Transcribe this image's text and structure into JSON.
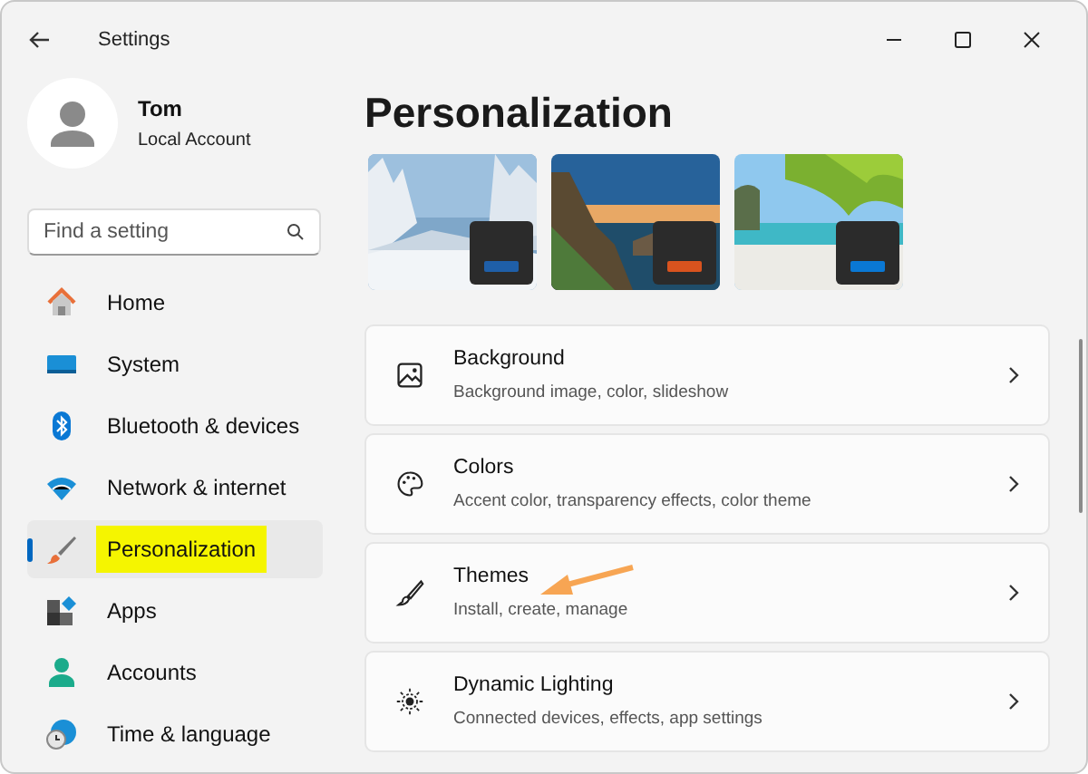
{
  "window": {
    "title": "Settings"
  },
  "account": {
    "name": "Tom",
    "type": "Local Account"
  },
  "search": {
    "placeholder": "Find a setting"
  },
  "sidebar": {
    "items": [
      {
        "label": "Home",
        "kind": "home",
        "selected": false,
        "highlighted": false
      },
      {
        "label": "System",
        "kind": "system",
        "selected": false,
        "highlighted": false
      },
      {
        "label": "Bluetooth & devices",
        "kind": "bluetooth",
        "selected": false,
        "highlighted": false
      },
      {
        "label": "Network & internet",
        "kind": "network",
        "selected": false,
        "highlighted": false
      },
      {
        "label": "Personalization",
        "kind": "personalization",
        "selected": true,
        "highlighted": true
      },
      {
        "label": "Apps",
        "kind": "apps",
        "selected": false,
        "highlighted": false
      },
      {
        "label": "Accounts",
        "kind": "accounts",
        "selected": false,
        "highlighted": false
      },
      {
        "label": "Time & language",
        "kind": "time",
        "selected": false,
        "highlighted": false
      }
    ]
  },
  "page": {
    "title": "Personalization",
    "cards": [
      {
        "kind": "background",
        "title": "Background",
        "description": "Background image, color, slideshow"
      },
      {
        "kind": "colors",
        "title": "Colors",
        "description": "Accent color, transparency effects, color theme"
      },
      {
        "kind": "themes",
        "title": "Themes",
        "description": "Install, create, manage"
      },
      {
        "kind": "lighting",
        "title": "Dynamic Lighting",
        "description": "Connected devices, effects, app settings"
      }
    ]
  }
}
